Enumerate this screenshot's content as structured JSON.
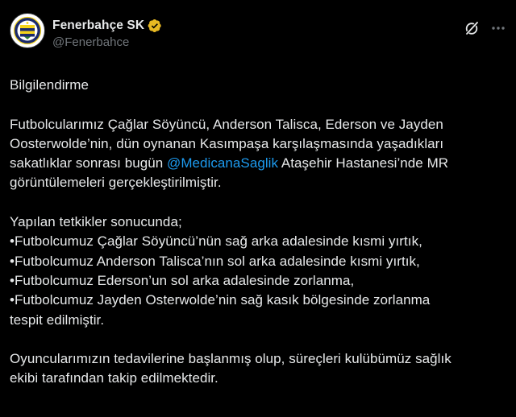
{
  "account": {
    "display_name": "Fenerbahçe SK",
    "handle": "@Fenerbahce",
    "verified_color": "#e8b923"
  },
  "actions": {
    "grok_icon": "grok-icon",
    "more_icon": "more-icon"
  },
  "tweet": {
    "heading": "Bilgilendirme",
    "para1": {
      "line1": "Futbolcularımız Çağlar Söyüncü, Anderson Talisca, Ederson ve Jayden",
      "line2": "Oosterwolde’nin, dün oynanan Kasımpaşa karşılaşmasında yaşadıkları",
      "line3_before": "sakatlıklar sonrası bugün ",
      "mention": "@MedicanaSaglik",
      "line3_after": " Ataşehir Hastanesi’nde MR",
      "line4": "görüntülemeleri gerçekleştirilmiştir."
    },
    "para2": {
      "intro": "Yapılan tetkikler sonucunda;",
      "items": [
        "•Futbolcumuz Çağlar Söyüncü’nün sağ arka adalesinde kısmi yırtık,",
        "•Futbolcumuz Anderson Talisca’nın sol arka adalesinde kısmi yırtık,",
        "•Futbolcumuz Ederson’un sol arka adalesinde zorlanma,",
        "•Futbolcumuz Jayden Osterwolde’nin sağ kasık bölgesinde zorlanma"
      ],
      "closing": "tespit edilmiştir."
    },
    "para3": {
      "line1": "Oyuncularımızın tedavilerine başlanmış olup, süreçleri kulübümüz sağlık",
      "line2": "ekibi tarafından takip edilmektedir."
    }
  },
  "colors": {
    "background": "#000000",
    "text": "#e7e9ea",
    "secondary": "#71767b",
    "link": "#1d9bf0"
  }
}
